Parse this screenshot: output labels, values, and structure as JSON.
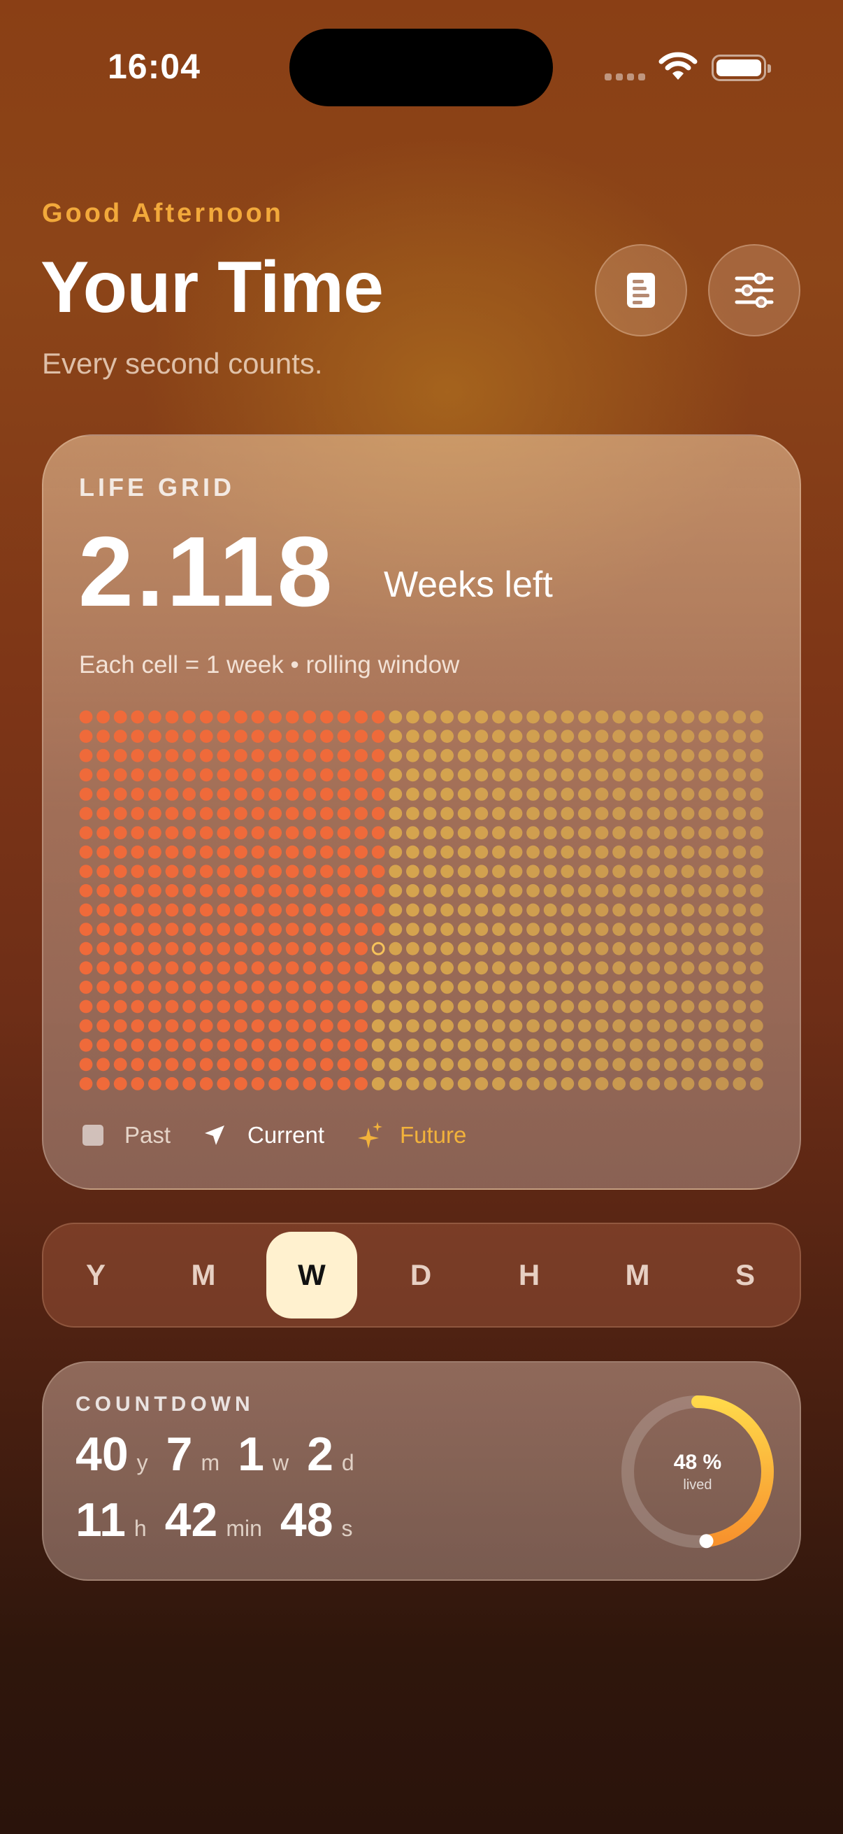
{
  "status_bar": {
    "time": "16:04"
  },
  "header": {
    "greeting": "Good Afternoon",
    "title": "Your Time",
    "subtitle": "Every second counts."
  },
  "icons": {
    "notes": "notes-icon",
    "settings": "sliders-icon",
    "current": "location-arrow-icon",
    "future": "sparkles-icon"
  },
  "life_grid": {
    "label": "LIFE GRID",
    "value": "2.118",
    "unit": "Weeks left",
    "caption": "Each cell = 1 week • rolling window",
    "columns": 40,
    "rows": 20,
    "current_row": 12,
    "current_col": 17,
    "colors": {
      "past": "#ef6a3a",
      "current": "#f6c25a",
      "future": "#d9a84e"
    },
    "legend": {
      "past": "Past",
      "current": "Current",
      "future": "Future"
    }
  },
  "units_selector": {
    "items": [
      "Y",
      "M",
      "W",
      "D",
      "H",
      "M",
      "S"
    ],
    "selected_index": 2
  },
  "countdown": {
    "label": "COUNTDOWN",
    "years": "40",
    "years_unit": "y",
    "months": "7",
    "months_unit": "m",
    "weeks": "1",
    "weeks_unit": "w",
    "days": "2",
    "days_unit": "d",
    "hours": "11",
    "hours_unit": "h",
    "minutes": "42",
    "minutes_unit": "min",
    "seconds": "48",
    "seconds_unit": "s",
    "percent_text": "48 %",
    "percent_value": 0.48,
    "percent_caption": "lived"
  }
}
